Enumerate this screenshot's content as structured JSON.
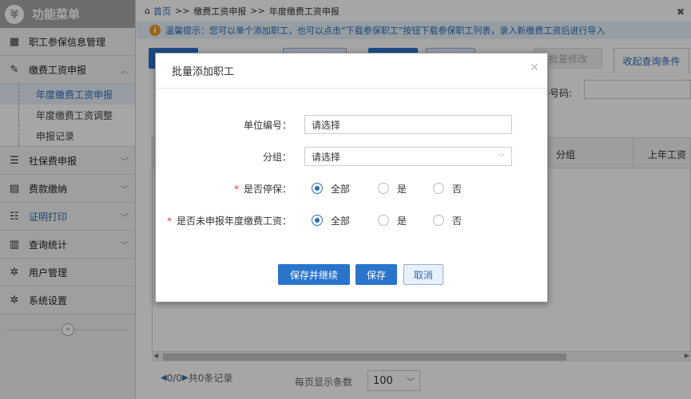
{
  "sidebar": {
    "logo_glyph": "¥",
    "title": "功能菜单",
    "items": [
      {
        "label": "职工参保信息管理",
        "icon": "table-icon"
      },
      {
        "label": "缴费工资申报",
        "icon": "edit-icon",
        "expanded": true
      },
      {
        "label": "社保费申报",
        "icon": "list-icon"
      },
      {
        "label": "费款缴纳",
        "icon": "book-icon"
      },
      {
        "label": "证明打印",
        "icon": "print-list-icon"
      },
      {
        "label": "查询统计",
        "icon": "chart-icon"
      },
      {
        "label": "用户管理",
        "icon": "gear-icon"
      },
      {
        "label": "系统设置",
        "icon": "gear-icon"
      }
    ],
    "subitems": [
      {
        "label": "年度缴费工资申报",
        "active": true
      },
      {
        "label": "年度缴费工资调整"
      },
      {
        "label": "申报记录"
      }
    ]
  },
  "breadcrumb": {
    "home": "首页",
    "sep": ">>",
    "level1": "缴费工资申报",
    "level2": "年度缴费工资申报"
  },
  "tip": "温馨提示：您可以单个添加职工，也可以点击“下载参保职工”按钮下载参保职工列表，录入新缴费工资后进行导入",
  "toolbar": {
    "bulk_edit": "批量修改",
    "fold_query": "收起查询条件",
    "id_label": "件号码:"
  },
  "grid": {
    "columns": [
      "分组",
      "上年工资"
    ]
  },
  "pager": {
    "info": "0/0",
    "total": "共0条记录",
    "per_page_label": "每页显示条数",
    "per_page_value": "100"
  },
  "modal": {
    "title": "批量添加职工",
    "unit_label": "单位编号：",
    "unit_value": "请选择",
    "group_label": "分组：",
    "group_value": "请选择",
    "stop_label": "是否停保：",
    "unreported_label": "是否未申报年度缴费工资：",
    "options": [
      "全部",
      "是",
      "否"
    ],
    "save_continue": "保存并继续",
    "save": "保存",
    "cancel": "取消"
  },
  "colors": {
    "accent": "#2a74cc",
    "sidebar_header": "#a6a6a6",
    "tip_bg": "#e7f1fb",
    "required": "#e53935"
  }
}
